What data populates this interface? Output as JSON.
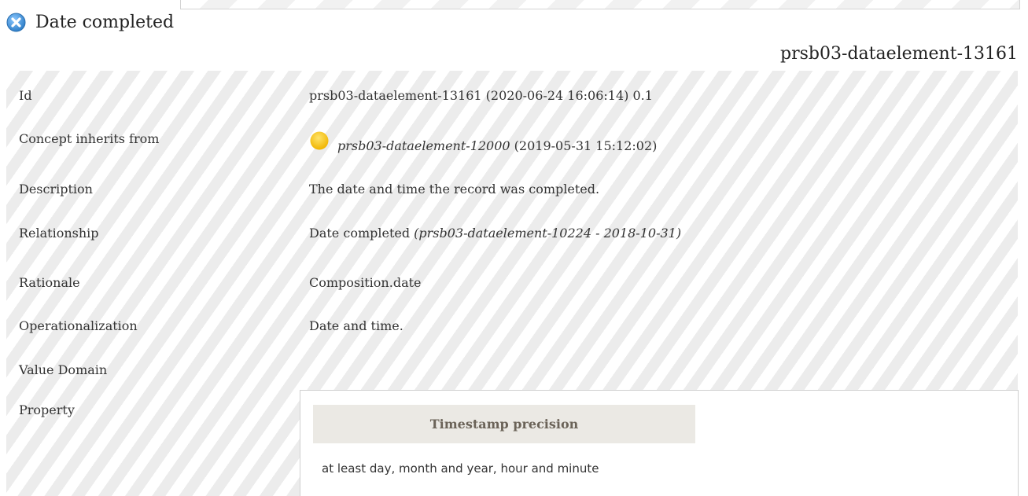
{
  "heading": {
    "title": "Date completed",
    "icon": "close-icon"
  },
  "element_id": "prsb03-dataelement-13161",
  "rows": {
    "id": {
      "label": "Id",
      "value": "prsb03-dataelement-13161 (2020-06-24 16:06:14) 0.1"
    },
    "inherits": {
      "label": "Concept inherits from",
      "ref": "prsb03-dataelement-12000",
      "date": " (2019-05-31 15:12:02)"
    },
    "description": {
      "label": "Description",
      "value": "The date and time the record was completed."
    },
    "relationship": {
      "label": "Relationship",
      "value": "Date completed ",
      "ref": "(prsb03-dataelement-10224 - 2018-10-31)"
    },
    "rationale": {
      "label": "Rationale",
      "value": "Composition.date"
    },
    "operationalization": {
      "label": "Operationalization",
      "value": "Date and time."
    },
    "value_domain": {
      "label": "Value Domain"
    },
    "property": {
      "label": "Property",
      "header": "Timestamp precision",
      "value": "at least day, month and year, hour and minute"
    }
  },
  "colors": {
    "close_icon": "#4a9fe0",
    "status_dot": "#f5c000",
    "property_header_bg": "#ebe9e4",
    "property_header_text": "#6b6358"
  }
}
